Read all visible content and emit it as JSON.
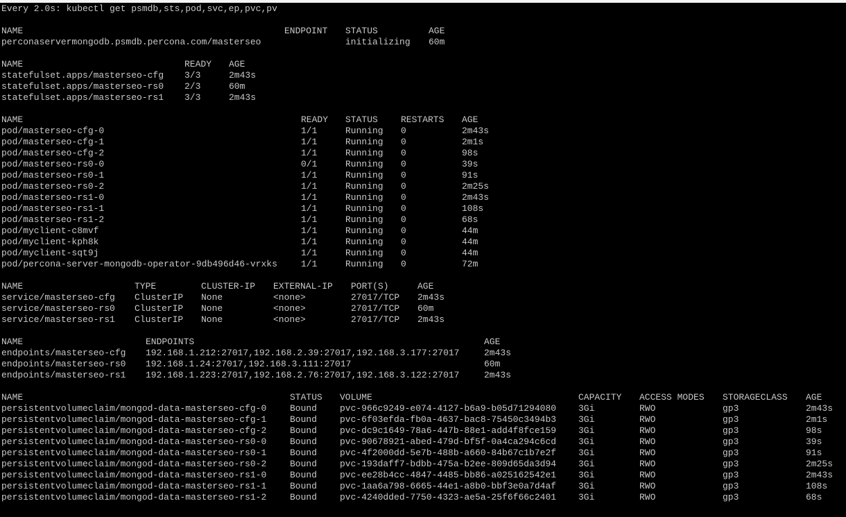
{
  "header": "Every 2.0s: kubectl get psmdb,sts,pod,svc,ep,pvc,pv",
  "psmdb": {
    "headers": [
      "NAME",
      "ENDPOINT",
      "STATUS",
      "AGE"
    ],
    "rows": [
      [
        "perconaservermongodb.psmdb.percona.com/masterseo",
        "",
        "initializing",
        "60m"
      ]
    ]
  },
  "sts": {
    "headers": [
      "NAME",
      "READY",
      "AGE"
    ],
    "rows": [
      [
        "statefulset.apps/masterseo-cfg",
        "3/3",
        "2m43s"
      ],
      [
        "statefulset.apps/masterseo-rs0",
        "2/3",
        "60m"
      ],
      [
        "statefulset.apps/masterseo-rs1",
        "3/3",
        "2m43s"
      ]
    ]
  },
  "pods": {
    "headers": [
      "NAME",
      "READY",
      "STATUS",
      "RESTARTS",
      "AGE"
    ],
    "rows": [
      [
        "pod/masterseo-cfg-0",
        "1/1",
        "Running",
        "0",
        "2m43s"
      ],
      [
        "pod/masterseo-cfg-1",
        "1/1",
        "Running",
        "0",
        "2m1s"
      ],
      [
        "pod/masterseo-cfg-2",
        "1/1",
        "Running",
        "0",
        "98s"
      ],
      [
        "pod/masterseo-rs0-0",
        "0/1",
        "Running",
        "0",
        "39s"
      ],
      [
        "pod/masterseo-rs0-1",
        "1/1",
        "Running",
        "0",
        "91s"
      ],
      [
        "pod/masterseo-rs0-2",
        "1/1",
        "Running",
        "0",
        "2m25s"
      ],
      [
        "pod/masterseo-rs1-0",
        "1/1",
        "Running",
        "0",
        "2m43s"
      ],
      [
        "pod/masterseo-rs1-1",
        "1/1",
        "Running",
        "0",
        "108s"
      ],
      [
        "pod/masterseo-rs1-2",
        "1/1",
        "Running",
        "0",
        "68s"
      ],
      [
        "pod/myclient-c8mvf",
        "1/1",
        "Running",
        "0",
        "44m"
      ],
      [
        "pod/myclient-kph8k",
        "1/1",
        "Running",
        "0",
        "44m"
      ],
      [
        "pod/myclient-sqt9j",
        "1/1",
        "Running",
        "0",
        "44m"
      ],
      [
        "pod/percona-server-mongodb-operator-9db496d46-vrxks",
        "1/1",
        "Running",
        "0",
        "72m"
      ]
    ]
  },
  "svc": {
    "headers": [
      "NAME",
      "TYPE",
      "CLUSTER-IP",
      "EXTERNAL-IP",
      "PORT(S)",
      "AGE"
    ],
    "rows": [
      [
        "service/masterseo-cfg",
        "ClusterIP",
        "None",
        "<none>",
        "27017/TCP",
        "2m43s"
      ],
      [
        "service/masterseo-rs0",
        "ClusterIP",
        "None",
        "<none>",
        "27017/TCP",
        "60m"
      ],
      [
        "service/masterseo-rs1",
        "ClusterIP",
        "None",
        "<none>",
        "27017/TCP",
        "2m43s"
      ]
    ]
  },
  "ep": {
    "headers": [
      "NAME",
      "ENDPOINTS",
      "AGE"
    ],
    "rows": [
      [
        "endpoints/masterseo-cfg",
        "192.168.1.212:27017,192.168.2.39:27017,192.168.3.177:27017",
        "2m43s"
      ],
      [
        "endpoints/masterseo-rs0",
        "192.168.1.24:27017,192.168.3.111:27017",
        "60m"
      ],
      [
        "endpoints/masterseo-rs1",
        "192.168.1.223:27017,192.168.2.76:27017,192.168.3.122:27017",
        "2m43s"
      ]
    ]
  },
  "pvc": {
    "headers": [
      "NAME",
      "STATUS",
      "VOLUME",
      "CAPACITY",
      "ACCESS MODES",
      "STORAGECLASS",
      "AGE"
    ],
    "rows": [
      [
        "persistentvolumeclaim/mongod-data-masterseo-cfg-0",
        "Bound",
        "pvc-966c9249-e074-4127-b6a9-b05d71294080",
        "3Gi",
        "RWO",
        "gp3",
        "2m43s"
      ],
      [
        "persistentvolumeclaim/mongod-data-masterseo-cfg-1",
        "Bound",
        "pvc-6f03efda-fb0a-4637-bac8-75450c3494b3",
        "3Gi",
        "RWO",
        "gp3",
        "2m1s"
      ],
      [
        "persistentvolumeclaim/mongod-data-masterseo-cfg-2",
        "Bound",
        "pvc-dc9c1649-78a6-447b-88e1-add4f8fce159",
        "3Gi",
        "RWO",
        "gp3",
        "98s"
      ],
      [
        "persistentvolumeclaim/mongod-data-masterseo-rs0-0",
        "Bound",
        "pvc-90678921-abed-479d-bf5f-0a4ca294c6cd",
        "3Gi",
        "RWO",
        "gp3",
        "39s"
      ],
      [
        "persistentvolumeclaim/mongod-data-masterseo-rs0-1",
        "Bound",
        "pvc-4f2000dd-5e7b-488b-a660-84b67c1b7e2f",
        "3Gi",
        "RWO",
        "gp3",
        "91s"
      ],
      [
        "persistentvolumeclaim/mongod-data-masterseo-rs0-2",
        "Bound",
        "pvc-193daff7-bdbb-475a-b2ee-809d65da3d94",
        "3Gi",
        "RWO",
        "gp3",
        "2m25s"
      ],
      [
        "persistentvolumeclaim/mongod-data-masterseo-rs1-0",
        "Bound",
        "pvc-ee28b4cc-4847-4485-bb86-a025162542e1",
        "3Gi",
        "RWO",
        "gp3",
        "2m43s"
      ],
      [
        "persistentvolumeclaim/mongod-data-masterseo-rs1-1",
        "Bound",
        "pvc-1aa6a798-6665-44e1-a8b0-bbf3e0a7d4af",
        "3Gi",
        "RWO",
        "gp3",
        "108s"
      ],
      [
        "persistentvolumeclaim/mongod-data-masterseo-rs1-2",
        "Bound",
        "pvc-4240dded-7750-4323-ae5a-25f6f66c2401",
        "3Gi",
        "RWO",
        "gp3",
        "68s"
      ]
    ]
  }
}
